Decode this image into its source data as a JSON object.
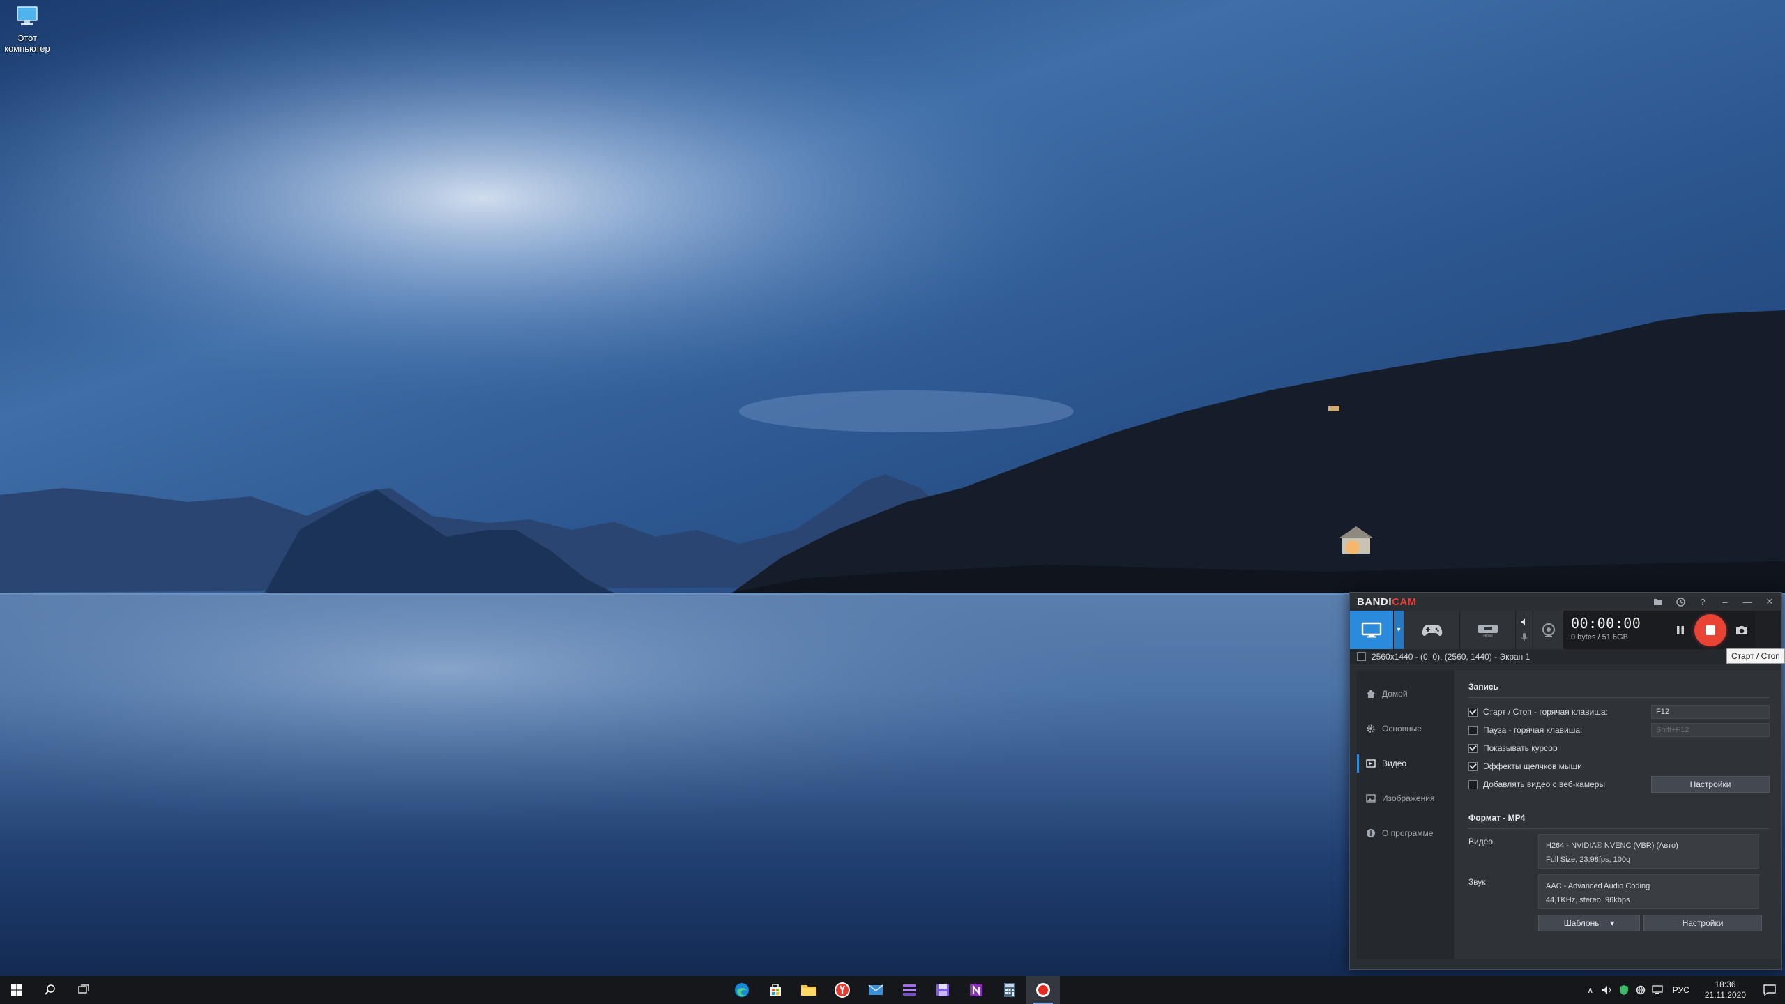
{
  "desktop": {
    "icon_label": "Этот компьютер"
  },
  "bandicam": {
    "logo_part1": "BANDI",
    "logo_part2": "CAM",
    "timer": "00:00:00",
    "size": "0 bytes / 51.6GB",
    "tooltip": "Старт / Стоп",
    "region": "2560x1440 - (0, 0), (2560, 1440) - Экран 1",
    "sidebar": [
      {
        "label": "Домой",
        "icon": "home-icon"
      },
      {
        "label": "Основные",
        "icon": "gear-icon"
      },
      {
        "label": "Видео",
        "icon": "video-icon"
      },
      {
        "label": "Изображения",
        "icon": "image-icon"
      },
      {
        "label": "О программе",
        "icon": "info-icon"
      }
    ],
    "record": {
      "title": "Запись",
      "startstop_label": "Старт / Стоп - горячая клавиша:",
      "startstop_key": "F12",
      "pause_label": "Пауза - горячая клавиша:",
      "pause_key": "Shift+F12",
      "cursor_label": "Показывать курсор",
      "clicks_label": "Эффекты щелчков мыши",
      "webcam_label": "Добавлять видео с веб-камеры",
      "settings_btn": "Настройки"
    },
    "format": {
      "title": "Формат - MP4",
      "video_label": "Видео",
      "video_line1": "H264 - NVIDIA® NVENC (VBR) (Авто)",
      "video_line2": "Full Size, 23,98fps, 100q",
      "audio_label": "Звук",
      "audio_line1": "AAC - Advanced Audio Coding",
      "audio_line2": "44,1KHz, stereo, 96kbps",
      "templates_btn": "Шаблоны",
      "settings_btn": "Настройки"
    }
  },
  "taskbar": {
    "lang": "РУС",
    "time": "18:36",
    "date": "21.11.2020"
  },
  "colors": {
    "accent_blue": "#2a8bdc",
    "record_red": "#e94336",
    "window_bg": "#2a2d31"
  }
}
